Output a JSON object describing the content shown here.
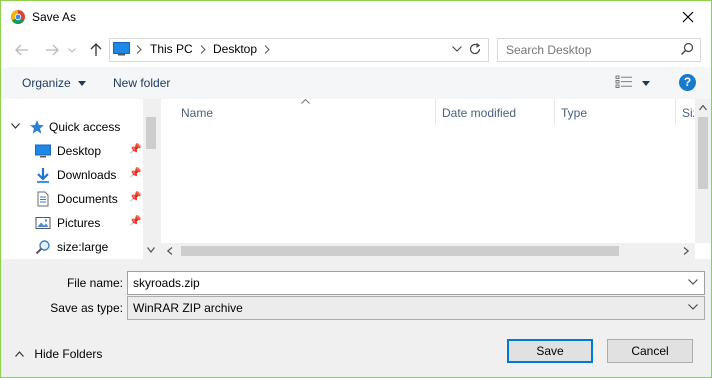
{
  "window": {
    "title": "Save As"
  },
  "address": {
    "crumbs": [
      "This PC",
      "Desktop"
    ]
  },
  "search": {
    "placeholder": "Search Desktop"
  },
  "toolbar": {
    "organize": "Organize",
    "new_folder": "New folder"
  },
  "help_label": "?",
  "nav": {
    "quick_access": "Quick access",
    "items": [
      {
        "label": "Desktop",
        "icon": "desktop-icon",
        "pinned": true
      },
      {
        "label": "Downloads",
        "icon": "downloads-icon",
        "pinned": true
      },
      {
        "label": "Documents",
        "icon": "documents-icon",
        "pinned": true
      },
      {
        "label": "Pictures",
        "icon": "pictures-icon",
        "pinned": true
      },
      {
        "label": "size:large",
        "icon": "search-icon",
        "pinned": false
      }
    ]
  },
  "columns": [
    "Name",
    "Date modified",
    "Type",
    "Size"
  ],
  "form": {
    "file_name_label": "File name:",
    "file_name_value": "skyroads.zip",
    "save_type_label": "Save as type:",
    "save_type_value": "WinRAR ZIP archive"
  },
  "footer": {
    "hide_folders": "Hide Folders",
    "save": "Save",
    "cancel": "Cancel"
  },
  "colors": {
    "accent": "#0078d7",
    "window_border": "#8dd24a",
    "help": "#1979ca"
  }
}
